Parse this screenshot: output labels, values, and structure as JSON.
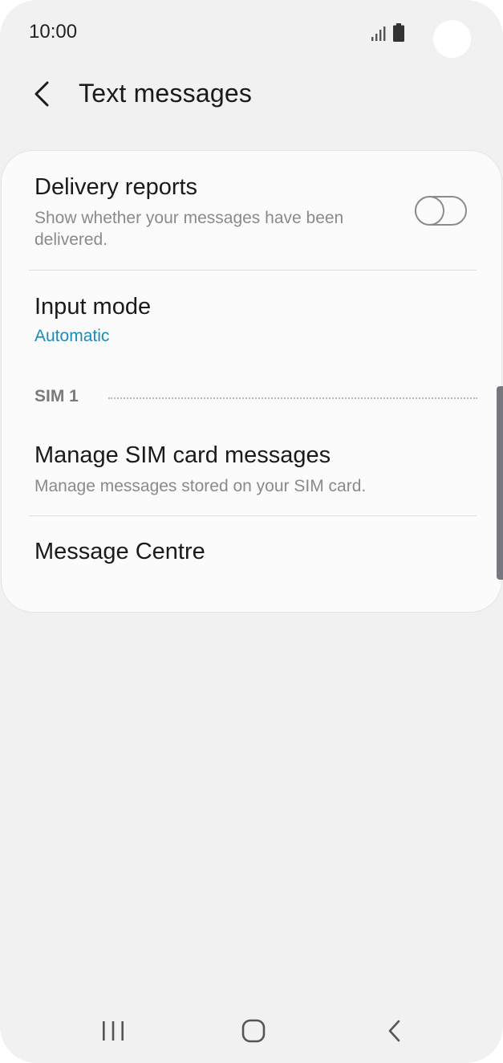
{
  "status_bar": {
    "time": "10:00",
    "icons": [
      "signal-icon",
      "battery-icon"
    ]
  },
  "header": {
    "title": "Text messages",
    "back_icon": "chevron-left-icon"
  },
  "settings": {
    "delivery_reports": {
      "title": "Delivery reports",
      "subtitle": "Show whether your messages have been delivered.",
      "toggle_on": false
    },
    "input_mode": {
      "title": "Input mode",
      "value": "Automatic"
    },
    "sim_section": {
      "label": "SIM 1"
    },
    "manage_sim": {
      "title": "Manage SIM card messages",
      "subtitle": "Manage messages stored on your SIM card."
    },
    "message_centre": {
      "title": "Message Centre"
    }
  },
  "nav_bar": {
    "buttons": [
      "recent-apps-icon",
      "home-icon",
      "back-icon"
    ]
  },
  "colors": {
    "background": "#f1f1f1",
    "card": "#fbfbfb",
    "accent": "#1a8bbd",
    "subtitle": "#8a8a8a"
  }
}
